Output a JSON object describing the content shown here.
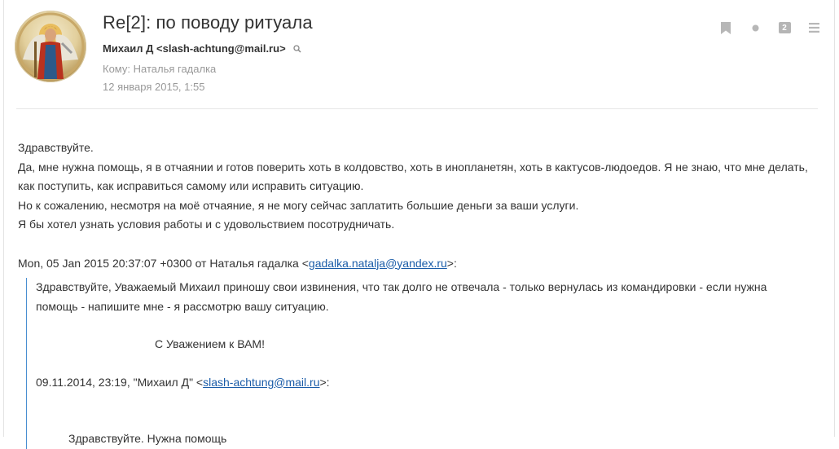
{
  "email": {
    "subject": "Re[2]: по поводу ритуала",
    "from_name": "Михаил Д",
    "from_address": "slash-achtung@mail.ru",
    "to": "Кому: Наталья гадалка",
    "date": "12 января 2015, 1:55"
  },
  "toolbar": {
    "thread_count": "2"
  },
  "body": {
    "greeting": "Здравствуйте.",
    "para1": "Да, мне нужна помощь, я в отчаянии и готов поверить хоть в колдовство, хоть в инопланетян, хоть в кактусов-людоедов. Я не знаю, что мне делать, как поступить, как исправиться самому или исправить ситуацию.",
    "para2": "Но к сожалению, несмотря на моё отчаяние, я не могу сейчас заплатить большие деньги за ваши услуги.",
    "para3": "Я бы хотел узнать условия работы и с удовольствием посотрудничать.",
    "quote_header_prefix": "Mon, 05 Jan 2015 20:37:07 +0300 от Наталья гадалка <",
    "quote_header_email": "gadalka.natalja@yandex.ru",
    "quote_header_suffix": ">:",
    "quote": {
      "para1": "Здравствуйте, Уважаемый Михаил приношу свои извинения, что так долго не отвечала - только вернулась из командировки - если нужна помощь - напишите мне - я рассмотрю вашу ситуацию.",
      "signoff": "С Уважением к ВАМ!",
      "nested_header_prefix": "09.11.2014, 23:19, \"Михаил Д\" <",
      "nested_header_email": "slash-achtung@mail.ru",
      "nested_header_suffix": ">:",
      "nested_cut": "Здравствуйте. Нужна помощь"
    }
  }
}
